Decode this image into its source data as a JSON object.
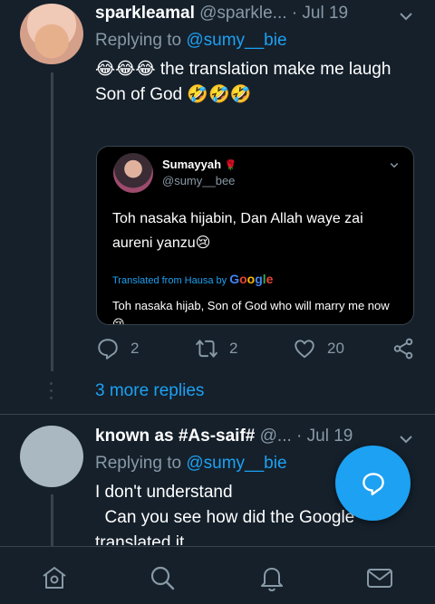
{
  "tweet1": {
    "name": "sparkleamal",
    "handle": "@sparkle...",
    "dot": "·",
    "date": "Jul 19",
    "replying_prefix": "Replying to ",
    "replying_to": "@sumy__bie",
    "text_line1": "😂😂😂 the translation make me laugh",
    "text_line2": "Son of God 🤣🤣🤣",
    "quote": {
      "name": "Sumayyah",
      "name_emoji": "🌹",
      "handle": "@sumy__bee",
      "text": "Toh nasaka hijabin, Dan Allah waye zai aureni yanzu😢",
      "translated_label": "Translated from Hausa by ",
      "translated_provider": [
        "G",
        "o",
        "o",
        "g",
        "l",
        "e"
      ],
      "translation": "Toh nasaka hijab, Son of God who will marry me now 😢"
    },
    "replies": "2",
    "retweets": "2",
    "likes": "20"
  },
  "more_replies": "3 more replies",
  "tweet2": {
    "name": "known as #As-saif#",
    "handle": "@...",
    "dot": "·",
    "date": "Jul 19",
    "replying_prefix": "Replying to ",
    "replying_to": "@sumy__bie",
    "text_line1": "I don't understand",
    "text_line2": "  Can you see how did the Google",
    "text_line3": "translated it"
  },
  "icons": {
    "reply": "reply-icon",
    "retweet": "retweet-icon",
    "like": "heart-icon",
    "share": "share-icon",
    "compose": "compose-reply-icon",
    "home": "home-icon",
    "search": "search-icon",
    "notifications": "bell-icon",
    "messages": "mail-icon"
  },
  "colors": {
    "background": "#15202b",
    "accent": "#1da1f2",
    "muted": "#8899a6",
    "border": "#38444d"
  }
}
